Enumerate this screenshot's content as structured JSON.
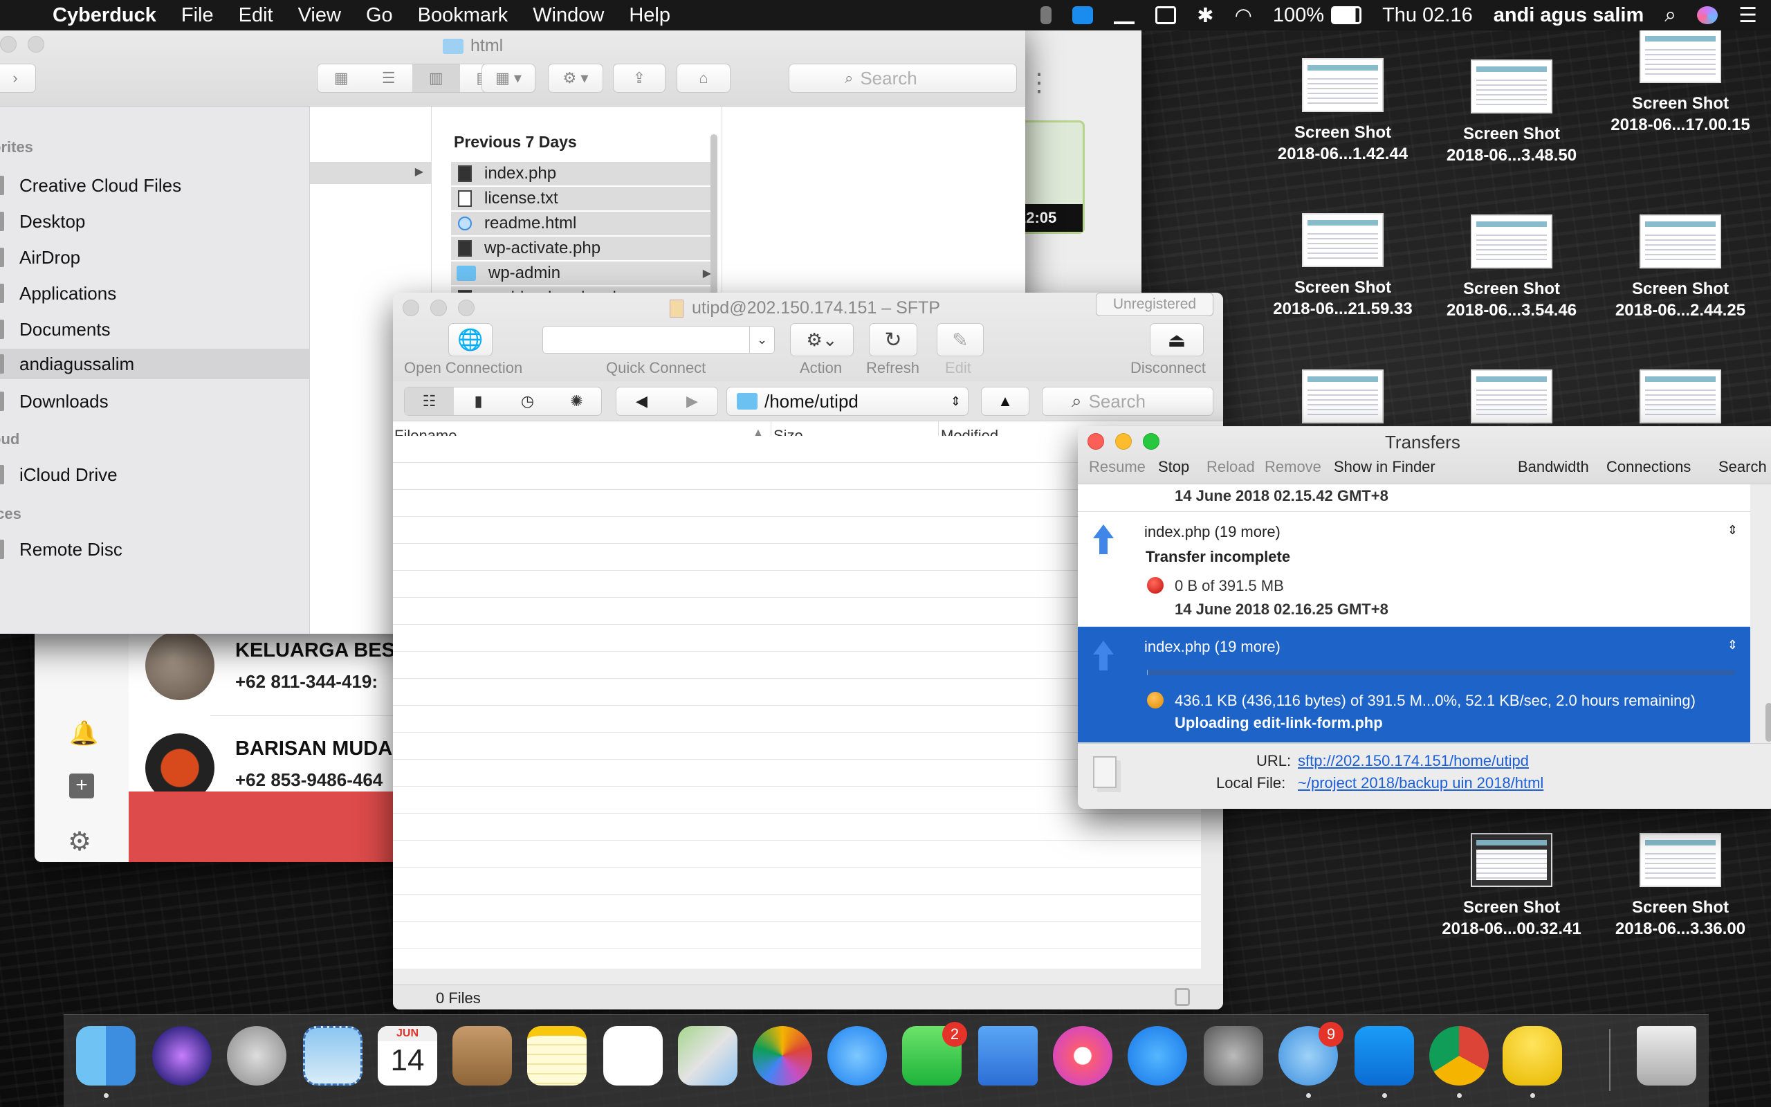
{
  "menubar": {
    "app": "Cyberduck",
    "items": [
      "File",
      "Edit",
      "View",
      "Go",
      "Bookmark",
      "Window",
      "Help"
    ],
    "battery": "100%",
    "clock": "Thu 02.16",
    "user": "andi agus salim"
  },
  "desktop_icons": [
    {
      "name": "Screen Shot",
      "sub": "2018-06...1.42.44"
    },
    {
      "name": "Screen Shot",
      "sub": "2018-06...3.48.50"
    },
    {
      "name": "Screen Shot",
      "sub": "2018-06...17.00.15"
    },
    {
      "name": "Screen Shot",
      "sub": "2018-06...21.59.33"
    },
    {
      "name": "Screen Shot",
      "sub": "2018-06...3.54.46"
    },
    {
      "name": "Screen Shot",
      "sub": "2018-06...2.44.25"
    },
    {
      "name": "Screen Shot",
      "sub": "2018-06...00.32.41"
    },
    {
      "name": "Screen Shot",
      "sub": "2018-06...3.36.00"
    }
  ],
  "finder": {
    "title": "html",
    "search_placeholder": "Search",
    "sections": [
      "orites",
      "oud",
      "ices",
      "s"
    ],
    "favorites": [
      "Creative Cloud Files",
      "Desktop",
      "AirDrop",
      "Applications",
      "Documents",
      "andiagussalim",
      "Downloads"
    ],
    "icloud": [
      "iCloud Drive"
    ],
    "devices": [
      "Remote Disc"
    ],
    "column_header": "Previous 7 Days",
    "files": [
      "index.php",
      "license.txt",
      "readme.html",
      "wp-activate.php",
      "wp-admin",
      "wp-blog-header.php"
    ]
  },
  "whatsapp": {
    "chats": [
      {
        "name": "KELUARGA BES",
        "number": "+62 811-344-419:"
      },
      {
        "name": "BARISAN MUDA",
        "number": "+62 853-9486-464"
      }
    ],
    "time": "22:05"
  },
  "cyberduck": {
    "title": "utipd@202.150.174.151 – SFTP",
    "unregistered": "Unregistered",
    "toolbar": {
      "open_connection": "Open Connection",
      "quick_connect": "Quick Connect",
      "action": "Action",
      "refresh": "Refresh",
      "edit": "Edit",
      "disconnect": "Disconnect"
    },
    "path": "/home/utipd",
    "search_placeholder": "Search",
    "columns": {
      "filename": "Filename",
      "size": "Size",
      "modified": "Modified"
    },
    "status": "0 Files"
  },
  "transfers": {
    "title": "Transfers",
    "toolbar": [
      "Resume",
      "Stop",
      "Reload",
      "Remove",
      "Show in Finder",
      "Bandwidth",
      "Connections",
      "Search"
    ],
    "items": [
      {
        "date": "14 June 2018 02.15.42 GMT+8"
      },
      {
        "file": "index.php (19 more)",
        "state": "Transfer incomplete",
        "progress": "0 B of 391.5 MB",
        "date": "14 June 2018 02.16.25 GMT+8"
      },
      {
        "file": "index.php (19 more)",
        "progress": "436.1 KB (436,116 bytes) of 391.5 M...0%, 52.1 KB/sec, 2.0 hours remaining)",
        "state": "Uploading edit-link-form.php",
        "progress_fraction": 0.001
      }
    ],
    "url_label": "URL:",
    "url": "sftp://202.150.174.151/home/utipd",
    "local_label": "Local File:",
    "local": "~/project 2018/backup uin 2018/html"
  },
  "dock": {
    "calendar_month": "JUN",
    "calendar_day": "14",
    "facetime_badge": "2",
    "tweetbot_badge": "9"
  }
}
